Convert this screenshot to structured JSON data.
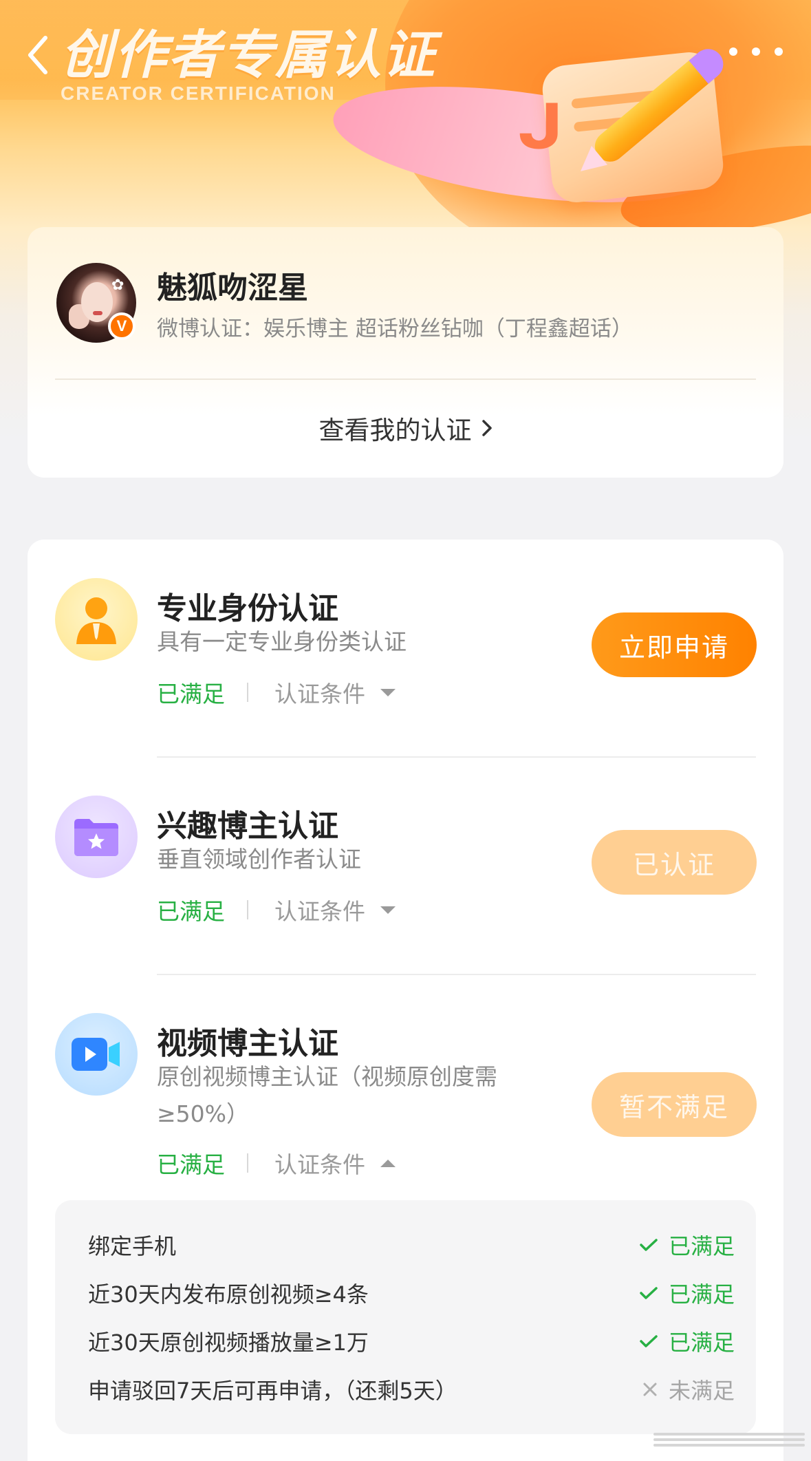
{
  "header": {
    "title": "创作者专属认证",
    "subtitle": "CREATOR CERTIFICATION"
  },
  "profile": {
    "name": "魅狐吻涩星",
    "verified_badge": "V",
    "certification": "微博认证：娱乐博主 超话粉丝钻咖（丁程鑫超话）",
    "view_link": "查看我的认证"
  },
  "certifications": [
    {
      "title": "专业身份认证",
      "description": "具有一定专业身份类认证",
      "status": "已满足",
      "conditions_label": "认证条件",
      "button": "立即申请",
      "icon": "person-badge-icon"
    },
    {
      "title": "兴趣博主认证",
      "description": "垂直领域创作者认证",
      "status": "已满足",
      "conditions_label": "认证条件",
      "button": "已认证",
      "icon": "folder-star-icon"
    },
    {
      "title": "视频博主认证",
      "description": "原创视频博主认证（视频原创度需≥50%）",
      "status": "已满足",
      "conditions_label": "认证条件",
      "button": "暂不满足",
      "icon": "video-camera-icon",
      "conditions": [
        {
          "label": "绑定手机",
          "result": "已满足",
          "met": true
        },
        {
          "label": "近30天内发布原创视频≥4条",
          "result": "已满足",
          "met": true
        },
        {
          "label": "近30天原创视频播放量≥1万",
          "result": "已满足",
          "met": true
        },
        {
          "label": "申请驳回7天后可再申请，（还剩5天）",
          "result": "未满足",
          "met": false
        }
      ]
    }
  ],
  "colors": {
    "accent": "#ff8a00",
    "success": "#27b043",
    "muted": "#8a8a8a"
  }
}
